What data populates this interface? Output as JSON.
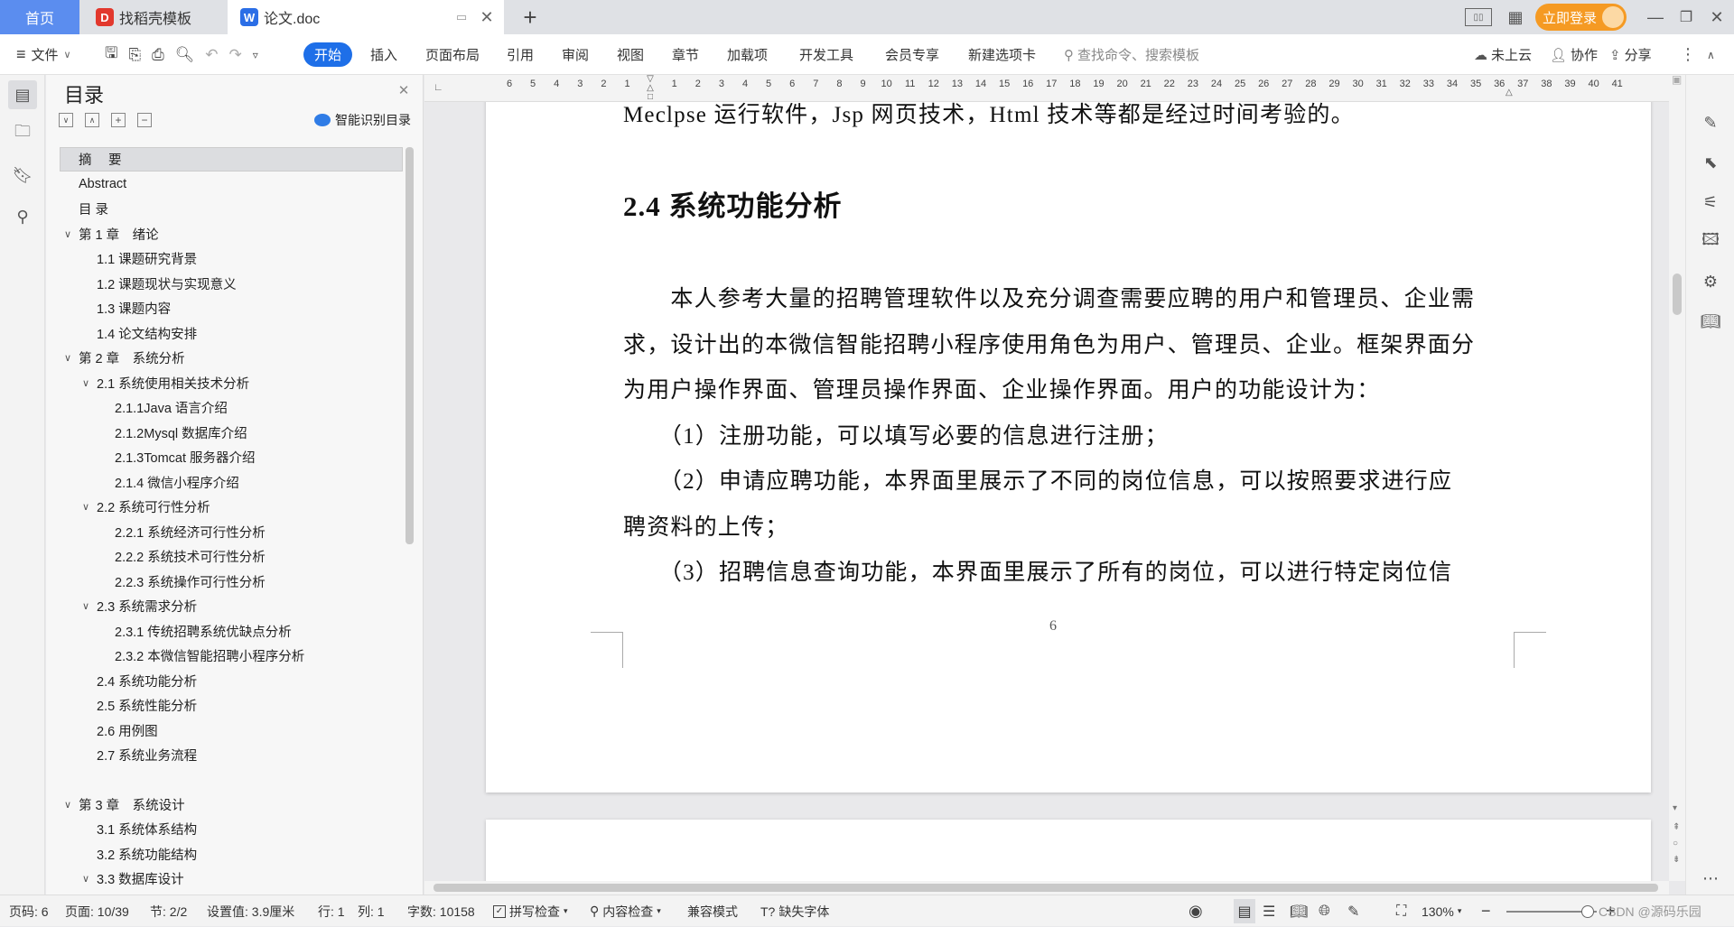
{
  "tabs": {
    "home": "首页",
    "templates": "找稻壳模板",
    "document": "论文.doc",
    "add": "+"
  },
  "title_right": {
    "login": "立即登录"
  },
  "toolbar": {
    "file": "文件",
    "tabs": [
      "开始",
      "插入",
      "页面布局",
      "引用",
      "审阅",
      "视图",
      "章节",
      "加载项",
      "开发工具",
      "会员专享",
      "新建选项卡"
    ],
    "search_placeholder": "查找命令、搜索模板",
    "cloud": "未上云",
    "collab": "协作",
    "share": "分享"
  },
  "nav": {
    "title": "目录",
    "smart_toc": "智能识别目录",
    "items": [
      {
        "label": "摘　要",
        "level": 1,
        "chev": ""
      },
      {
        "label": "Abstract",
        "level": 1,
        "chev": ""
      },
      {
        "label": "目 录",
        "level": 1,
        "chev": ""
      },
      {
        "label": "第 1 章　绪论",
        "level": 1,
        "chev": "v"
      },
      {
        "label": "1.1 课题研究背景",
        "level": 2,
        "chev": ""
      },
      {
        "label": "1.2 课题现状与实现意义",
        "level": 2,
        "chev": ""
      },
      {
        "label": "1.3 课题内容",
        "level": 2,
        "chev": ""
      },
      {
        "label": "1.4 论文结构安排",
        "level": 2,
        "chev": ""
      },
      {
        "label": "第 2 章　系统分析",
        "level": 1,
        "chev": "v"
      },
      {
        "label": "2.1 系统使用相关技术分析",
        "level": 2,
        "chev": "v"
      },
      {
        "label": "2.1.1Java 语言介绍",
        "level": 3,
        "chev": ""
      },
      {
        "label": "2.1.2Mysql 数据库介绍",
        "level": 3,
        "chev": ""
      },
      {
        "label": "2.1.3Tomcat 服务器介绍",
        "level": 3,
        "chev": ""
      },
      {
        "label": "2.1.4 微信小程序介绍",
        "level": 3,
        "chev": ""
      },
      {
        "label": "2.2 系统可行性分析",
        "level": 2,
        "chev": "v"
      },
      {
        "label": "2.2.1 系统经济可行性分析",
        "level": 3,
        "chev": ""
      },
      {
        "label": "2.2.2 系统技术可行性分析",
        "level": 3,
        "chev": ""
      },
      {
        "label": "2.2.3 系统操作可行性分析",
        "level": 3,
        "chev": ""
      },
      {
        "label": "2.3 系统需求分析",
        "level": 2,
        "chev": "v"
      },
      {
        "label": "2.3.1 传统招聘系统优缺点分析",
        "level": 3,
        "chev": ""
      },
      {
        "label": "2.3.2 本微信智能招聘小程序分析",
        "level": 3,
        "chev": ""
      },
      {
        "label": "2.4 系统功能分析",
        "level": 2,
        "chev": ""
      },
      {
        "label": "2.5 系统性能分析",
        "level": 2,
        "chev": ""
      },
      {
        "label": "2.6 用例图",
        "level": 2,
        "chev": ""
      },
      {
        "label": "2.7 系统业务流程",
        "level": 2,
        "chev": ""
      },
      {
        "label": "第 3 章　系统设计",
        "level": 1,
        "chev": "v"
      },
      {
        "label": "3.1 系统体系结构",
        "level": 2,
        "chev": ""
      },
      {
        "label": "3.2 系统功能结构",
        "level": 2,
        "chev": ""
      },
      {
        "label": "3.3 数据库设计",
        "level": 2,
        "chev": "v"
      }
    ]
  },
  "ruler_ticks": [
    "6",
    "5",
    "4",
    "3",
    "2",
    "1",
    "",
    "1",
    "2",
    "3",
    "4",
    "5",
    "6",
    "7",
    "8",
    "9",
    "10",
    "11",
    "12",
    "13",
    "14",
    "15",
    "16",
    "17",
    "18",
    "19",
    "20",
    "21",
    "22",
    "23",
    "24",
    "25",
    "26",
    "27",
    "28",
    "29",
    "30",
    "31",
    "32",
    "33",
    "34",
    "35",
    "36",
    "37",
    "38",
    "39",
    "40",
    "41"
  ],
  "document": {
    "line0": "Meclpse 运行软件，Jsp 网页技术，Html 技术等都是经过时间考验的。",
    "heading": "2.4 系统功能分析",
    "p1": "　　本人参考大量的招聘管理软件以及充分调查需要应聘的用户和管理员、企业需",
    "p2": "求，设计出的本微信智能招聘小程序使用角色为用户、管理员、企业。框架界面分",
    "p3": "为用户操作界面、管理员操作界面、企业操作界面。用户的功能设计为：",
    "p4": "　　（1）注册功能，可以填写必要的信息进行注册；",
    "p5": "　　（2）申请应聘功能，本界面里展示了不同的岗位信息，可以按照要求进行应",
    "p6": "聘资料的上传；",
    "p7": "　　（3）招聘信息查询功能，本界面里展示了所有的岗位，可以进行特定岗位信",
    "page_number": "6"
  },
  "status": {
    "page_code": "页码: 6",
    "page": "页面: 10/39",
    "section": "节: 2/2",
    "setting": "设置值: 3.9厘米",
    "row": "行: 1",
    "col": "列: 1",
    "words": "字数: 10158",
    "spell": "拼写检查",
    "content_check": "内容检查",
    "compat": "兼容模式",
    "missing_font": "缺失字体",
    "zoom": "130%"
  },
  "watermark": "CSDN @源码乐园",
  "colors": {
    "accent": "#1e6fe8",
    "home_tab": "#5b8def",
    "login": "#f59a23"
  }
}
